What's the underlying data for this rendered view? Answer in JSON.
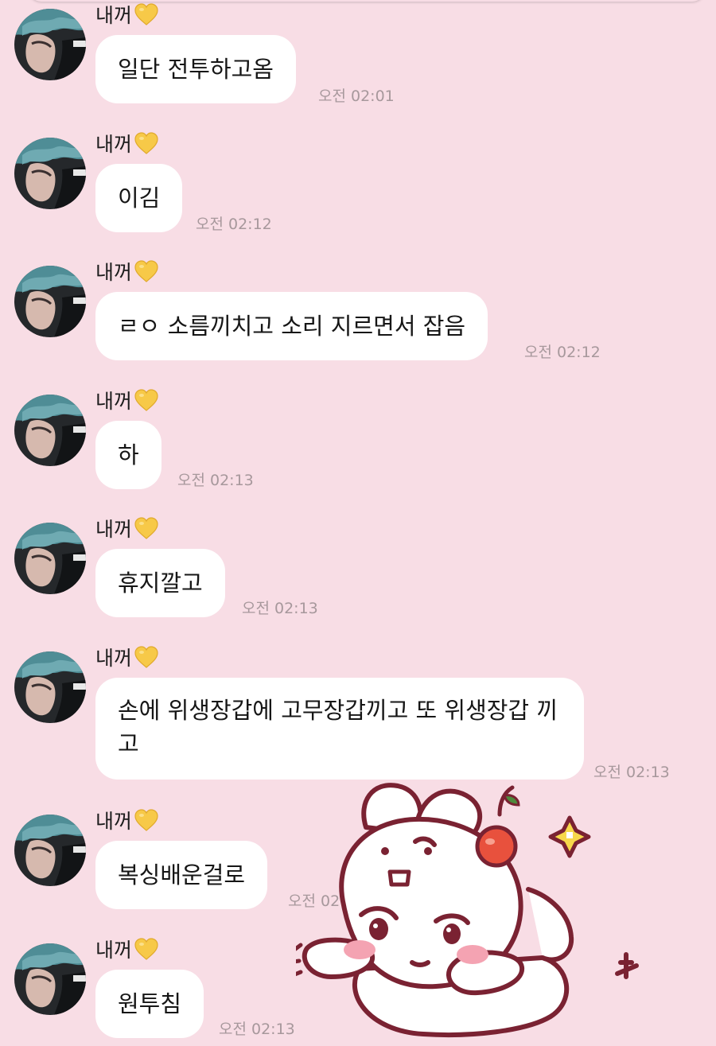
{
  "messages": [
    {
      "sender": "내꺼",
      "text": "일단 전투하고옴",
      "time": "오전 02:01"
    },
    {
      "sender": "내꺼",
      "text": "이김",
      "time": "오전 02:12"
    },
    {
      "sender": "내꺼",
      "text": "ㄹㅇ 소름끼치고 소리 지르면서 잡음",
      "time": "오전 02:12"
    },
    {
      "sender": "내꺼",
      "text": "하",
      "time": "오전 02:13"
    },
    {
      "sender": "내꺼",
      "text": "휴지깔고",
      "time": "오전 02:13"
    },
    {
      "sender": "내꺼",
      "text": "손에 위생장갑에 고무장갑끼고 또 위생장갑 끼고",
      "time": "오전 02:13"
    },
    {
      "sender": "내꺼",
      "text": "복싱배운걸로",
      "time": "오전 02:13"
    },
    {
      "sender": "내꺼",
      "text": "원투침",
      "time": "오전 02:13"
    }
  ],
  "icons": {
    "heart": "yellow-heart-emoji",
    "sticker": "white-bunny-with-cherry-sticker"
  },
  "colors": {
    "background": "#f8dde5",
    "bubble": "#ffffff",
    "timestamp": "#a7989c",
    "heart": "#f7c948"
  }
}
